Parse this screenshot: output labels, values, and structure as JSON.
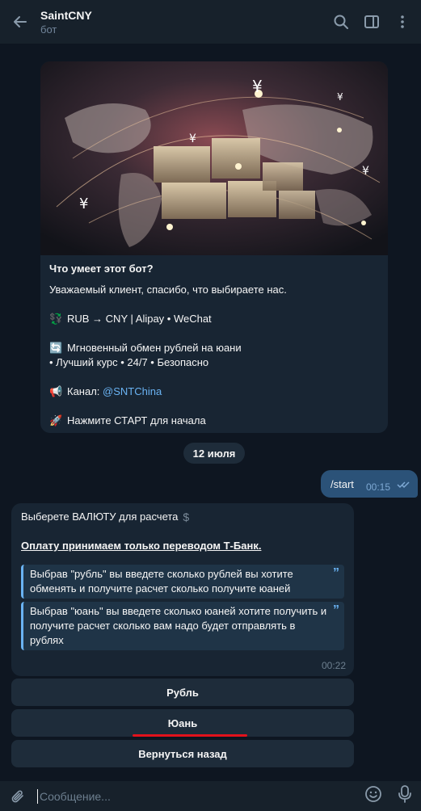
{
  "header": {
    "title": "SaintCNY",
    "subtitle": "бот"
  },
  "intro": {
    "heading": "Что умеет этот бот?",
    "line1": "Уважаемый клиент, спасибо, что выбираете нас.",
    "line2_emoji": "💱",
    "line2": "RUB → CNY | Alipay • WeChat",
    "line3_emoji": "🔄",
    "line3": "Мгновенный обмен рублей на юани",
    "line4": "• Лучший курс • 24/7 • Безопасно",
    "line5_emoji": "📢",
    "line5_prefix": "Канал: ",
    "line5_link": "@SNTChina",
    "line6_emoji": "🚀",
    "line6": "Нажмите СТАРТ для начала"
  },
  "date_chip": "12 июля",
  "outgoing": {
    "text": "/start",
    "time": "00:15"
  },
  "incoming": {
    "line1": "Выберете ВАЛЮТУ для расчета",
    "dollar": "$",
    "underline": "Оплату принимаем только переводом Т-Банк.",
    "quote1": "Выбрав \"рубль\" вы введете сколько рублей вы хотите обменять и получите расчет сколько получите юаней",
    "quote2": "Выбрав \"юань\" вы введете сколько юаней хотите получить и получите расчет сколько вам надо будет отправлять в рублях",
    "quote_mark": "”",
    "time": "00:22"
  },
  "buttons": {
    "rub": "Рубль",
    "yuan": "Юань",
    "back": "Вернуться назад"
  },
  "composer": {
    "placeholder": "Сообщение..."
  },
  "colors": {
    "accent": "#6ab3f3",
    "outgoing_bubble": "#2b5278",
    "incoming_bubble": "#182533",
    "highlight_red": "#e3121b"
  }
}
